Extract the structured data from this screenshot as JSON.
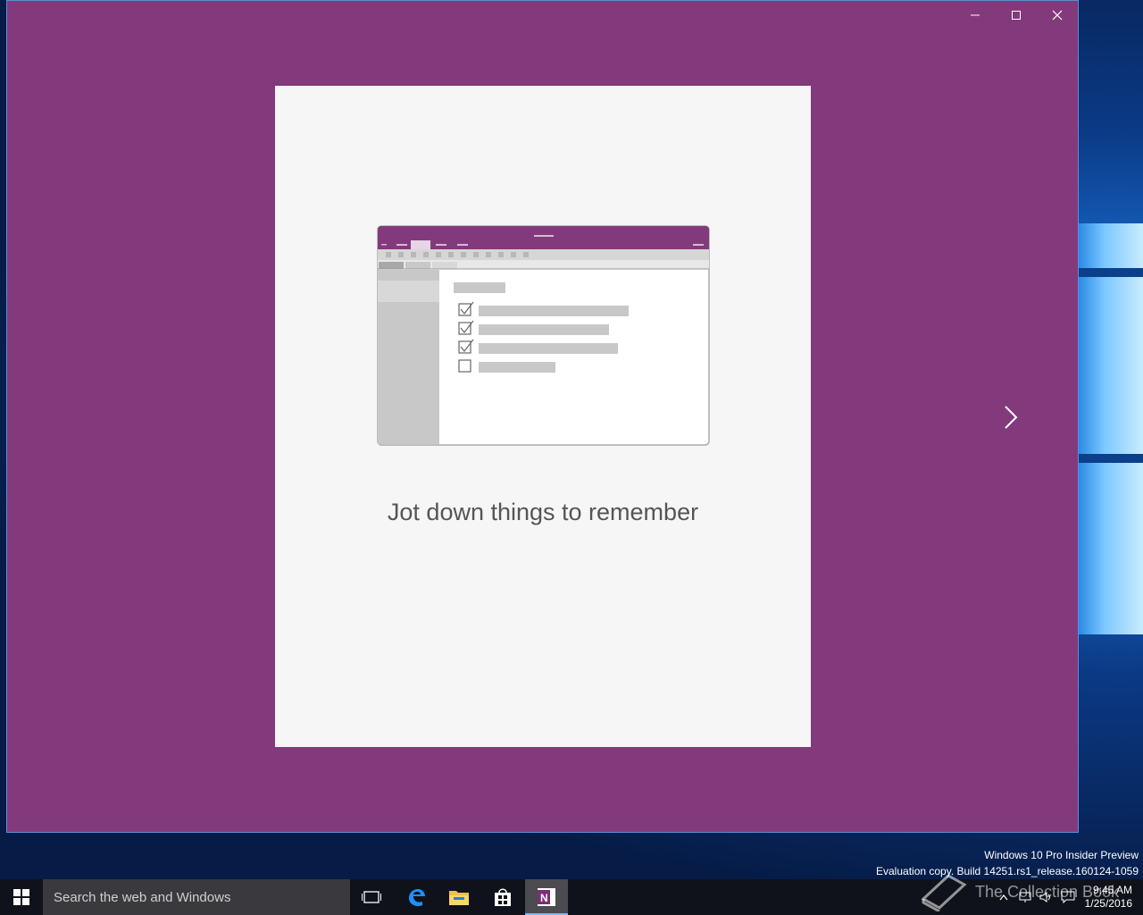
{
  "window": {
    "caption": "Jot down things to remember",
    "controls": {
      "minimize": "minimize-icon",
      "maximize": "maximize-icon",
      "close": "close-icon"
    }
  },
  "colors": {
    "onenote_purple": "#833a7c",
    "card_bg": "#f6f6f6",
    "taskbar": "#101014"
  },
  "watermark": {
    "line1": "Windows 10 Pro Insider Preview",
    "line2": "Evaluation copy. Build 14251.rs1_release.160124-1059",
    "collection": "The Collection Book"
  },
  "taskbar": {
    "search_placeholder": "Search the web and Windows",
    "apps": [
      "task-view",
      "edge",
      "file-explorer",
      "store",
      "onenote"
    ],
    "clock_time": "9:45 AM",
    "clock_date": "1/25/2016"
  }
}
